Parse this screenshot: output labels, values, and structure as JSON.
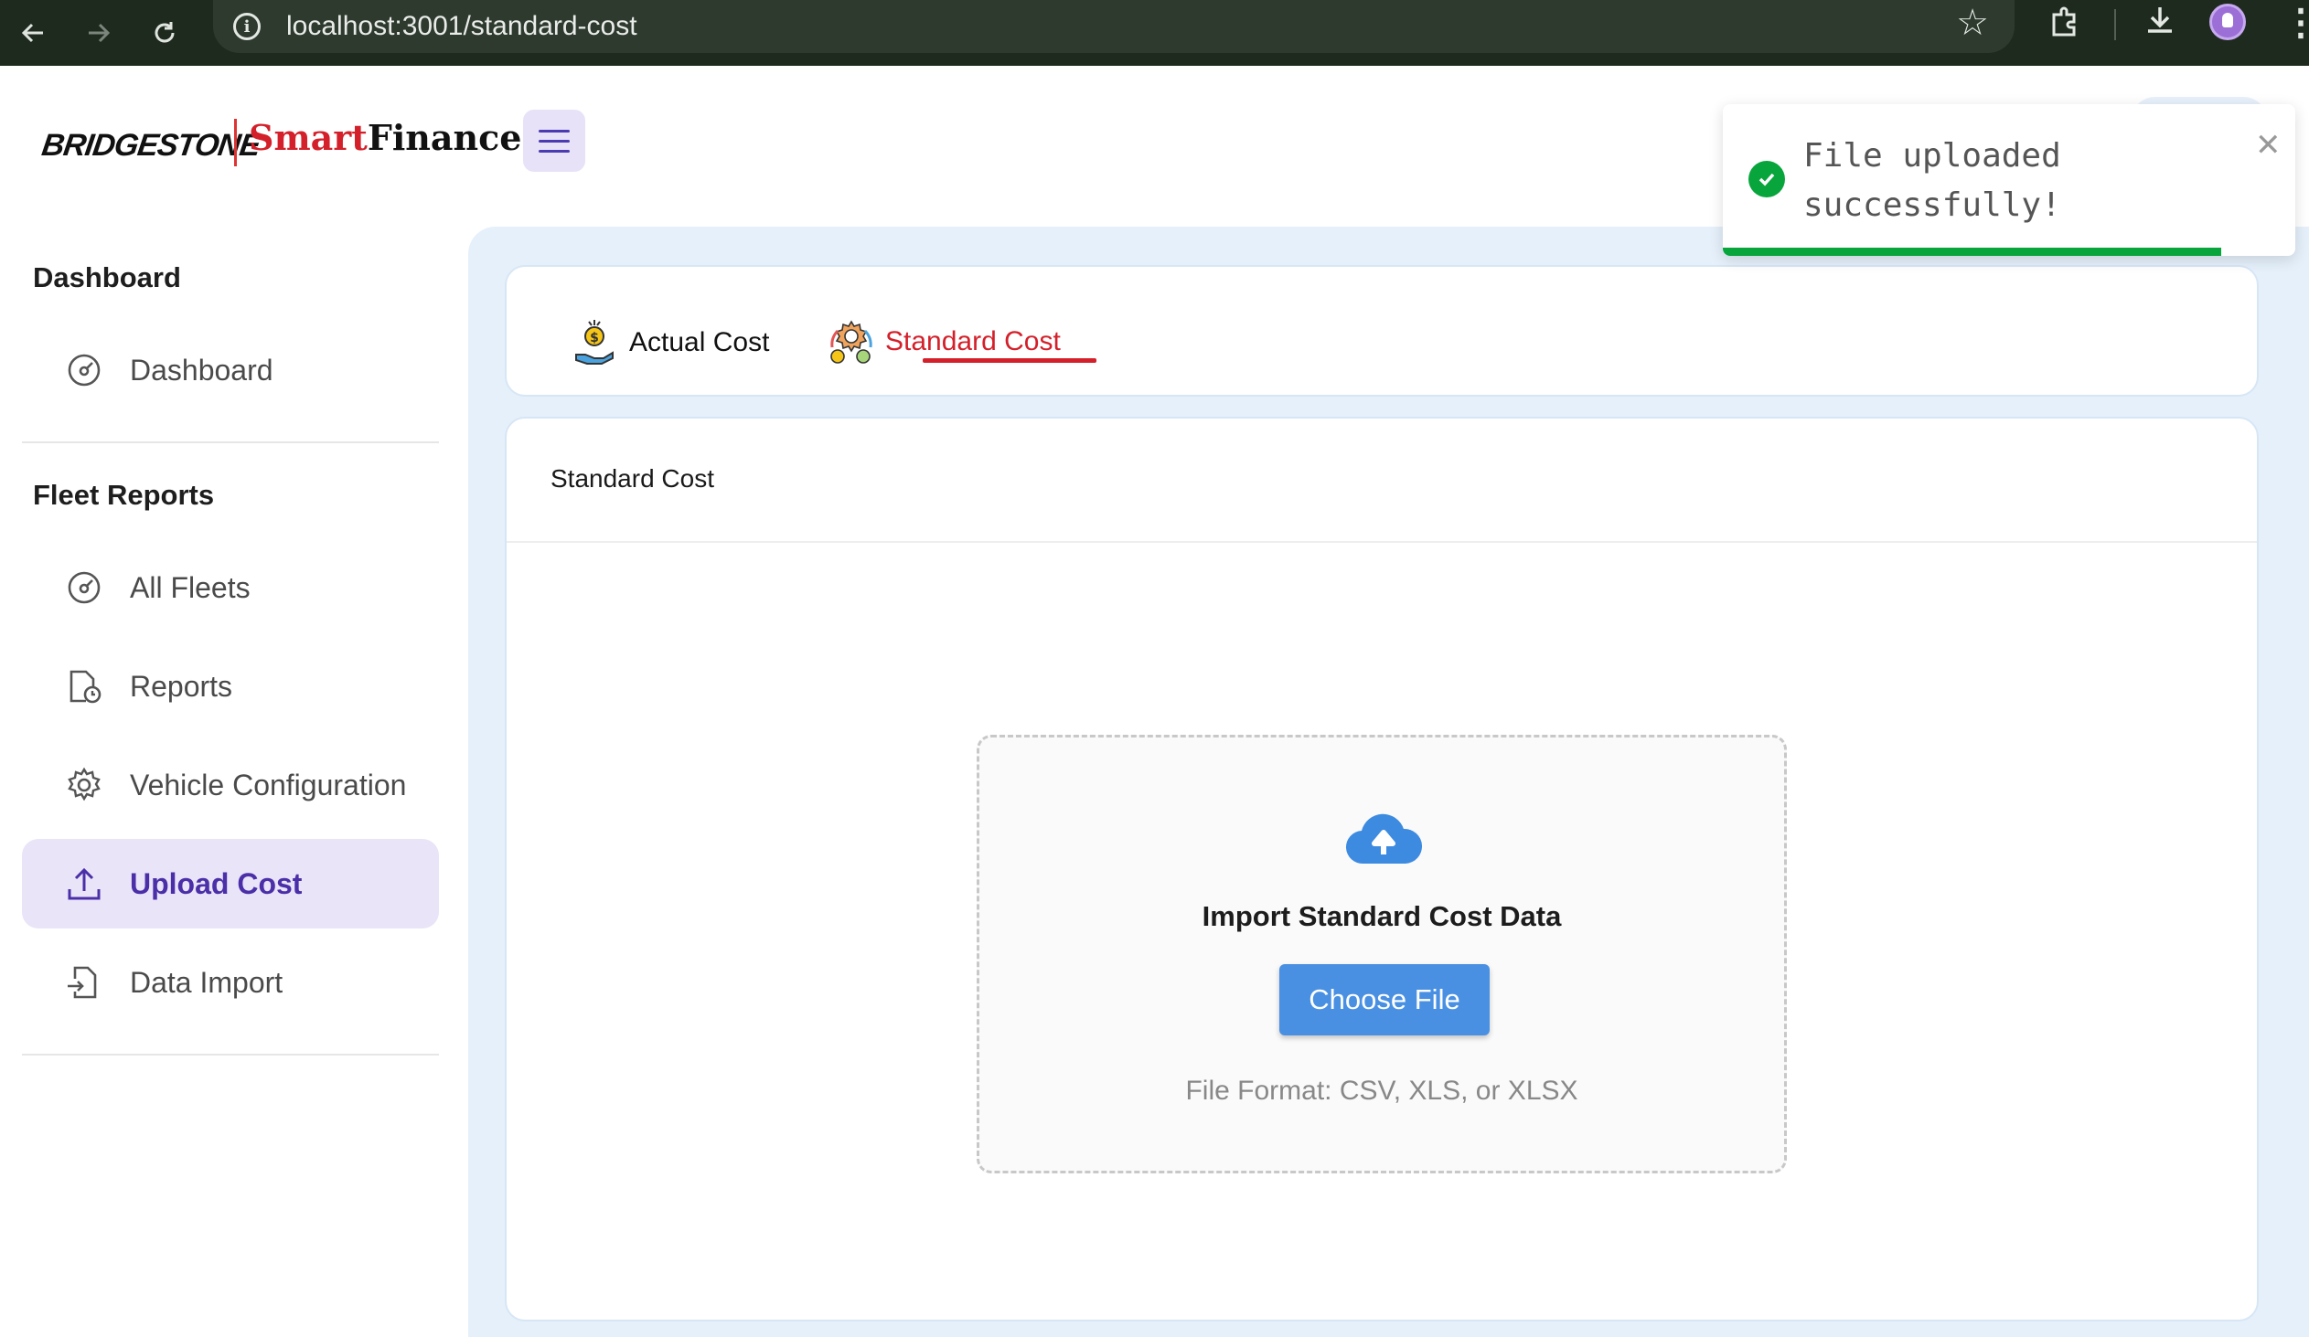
{
  "browser": {
    "url": "localhost:3001/standard-cost",
    "back_icon": "arrow-left-icon",
    "forward_icon": "arrow-right-icon",
    "reload_icon": "reload-icon",
    "info_icon": "info-icon",
    "bookmark_icon": "star-icon",
    "extensions_icon": "puzzle-icon",
    "download_icon": "download-icon",
    "menu_icon": "kebab-icon"
  },
  "header": {
    "brand": "BRIDGESTONE",
    "app_name_part1": "Smart",
    "app_name_part2": "Finance",
    "menu_icon": "hamburger-icon"
  },
  "sidebar": {
    "sections": [
      {
        "title": "Dashboard",
        "items": [
          {
            "label": "Dashboard",
            "icon": "gauge-icon",
            "active": false
          }
        ]
      },
      {
        "title": "Fleet Reports",
        "items": [
          {
            "label": "All Fleets",
            "icon": "gauge-icon",
            "active": false
          },
          {
            "label": "Reports",
            "icon": "report-clock-icon",
            "active": false
          },
          {
            "label": "Vehicle Configuration",
            "icon": "gear-icon",
            "active": false
          },
          {
            "label": "Upload Cost",
            "icon": "upload-icon",
            "active": true
          },
          {
            "label": "Data Import",
            "icon": "file-import-icon",
            "active": false
          }
        ]
      }
    ]
  },
  "tabs": [
    {
      "label": "Actual Cost",
      "icon": "money-hand-icon",
      "active": false
    },
    {
      "label": "Standard Cost",
      "icon": "money-gear-icon",
      "active": true
    }
  ],
  "content": {
    "title": "Standard Cost",
    "dropzone": {
      "icon": "cloud-upload-icon",
      "title": "Import Standard Cost Data",
      "button_label": "Choose File",
      "format_hint": "File Format: CSV, XLS, or XLSX"
    }
  },
  "toast": {
    "message": "File uploaded successfully!",
    "icon": "check-circle-icon",
    "close_icon": "close-icon",
    "progress": 0.87
  },
  "colors": {
    "accent_red": "#d3202a",
    "active_purple": "#4a2fa8",
    "primary_blue": "#4a90e2",
    "success_green": "#07a53b",
    "main_bg": "#e5f0fb"
  }
}
